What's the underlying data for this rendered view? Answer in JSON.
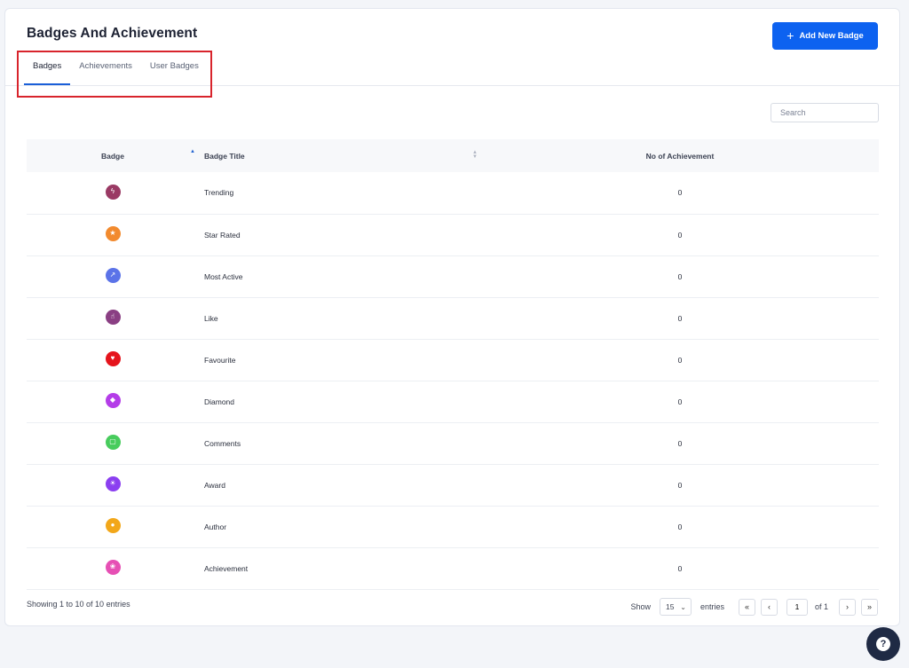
{
  "header": {
    "title": "Badges And Achievement",
    "add_button_label": "Add New Badge"
  },
  "tabs": [
    {
      "label": "Badges",
      "active": true
    },
    {
      "label": "Achievements",
      "active": false
    },
    {
      "label": "User Badges",
      "active": false
    }
  ],
  "search": {
    "placeholder": "Search",
    "value": ""
  },
  "table": {
    "columns": [
      "Badge",
      "Badge Title",
      "No of Achievement"
    ],
    "rows": [
      {
        "icon": "lightning-icon",
        "glyph": "ϟ",
        "color": "#9a3a64",
        "title": "Trending",
        "count": "0"
      },
      {
        "icon": "star-icon",
        "glyph": "★",
        "color": "#f28a2e",
        "title": "Star Rated",
        "count": "0"
      },
      {
        "icon": "pin-icon",
        "glyph": "↗",
        "color": "#5b73e8",
        "title": "Most Active",
        "count": "0"
      },
      {
        "icon": "thumbs-up-icon",
        "glyph": "☝",
        "color": "#8a3f83",
        "title": "Like",
        "count": "0"
      },
      {
        "icon": "heart-icon",
        "glyph": "♥",
        "color": "#e5141c",
        "title": "Favourite",
        "count": "0"
      },
      {
        "icon": "diamond-icon",
        "glyph": "◆",
        "color": "#b43de8",
        "title": "Diamond",
        "count": "0"
      },
      {
        "icon": "comment-icon",
        "glyph": "▢",
        "color": "#48cc5d",
        "title": "Comments",
        "count": "0"
      },
      {
        "icon": "trophy-icon",
        "glyph": "☀",
        "color": "#8b3ff0",
        "title": "Award",
        "count": "0"
      },
      {
        "icon": "user-icon",
        "glyph": "●",
        "color": "#f2a71a",
        "title": "Author",
        "count": "0"
      },
      {
        "icon": "medal-icon",
        "glyph": "❀",
        "color": "#e64fb4",
        "title": "Achievement",
        "count": "0"
      }
    ]
  },
  "footer": {
    "info": "Showing 1 to 10 of 10 entries",
    "show_label": "Show",
    "page_size": "15",
    "entries_label": "entries",
    "first": "«",
    "prev": "‹",
    "current_page": "1",
    "of_label": "of 1",
    "next": "›",
    "last": "»"
  },
  "colors": {
    "accent": "#0d62f0",
    "tab_underline": "#1a5fd8",
    "highlight_box": "#d8242c",
    "help_button": "#1f2a44"
  },
  "help_button": {
    "icon": "question-icon",
    "glyph": "?"
  }
}
